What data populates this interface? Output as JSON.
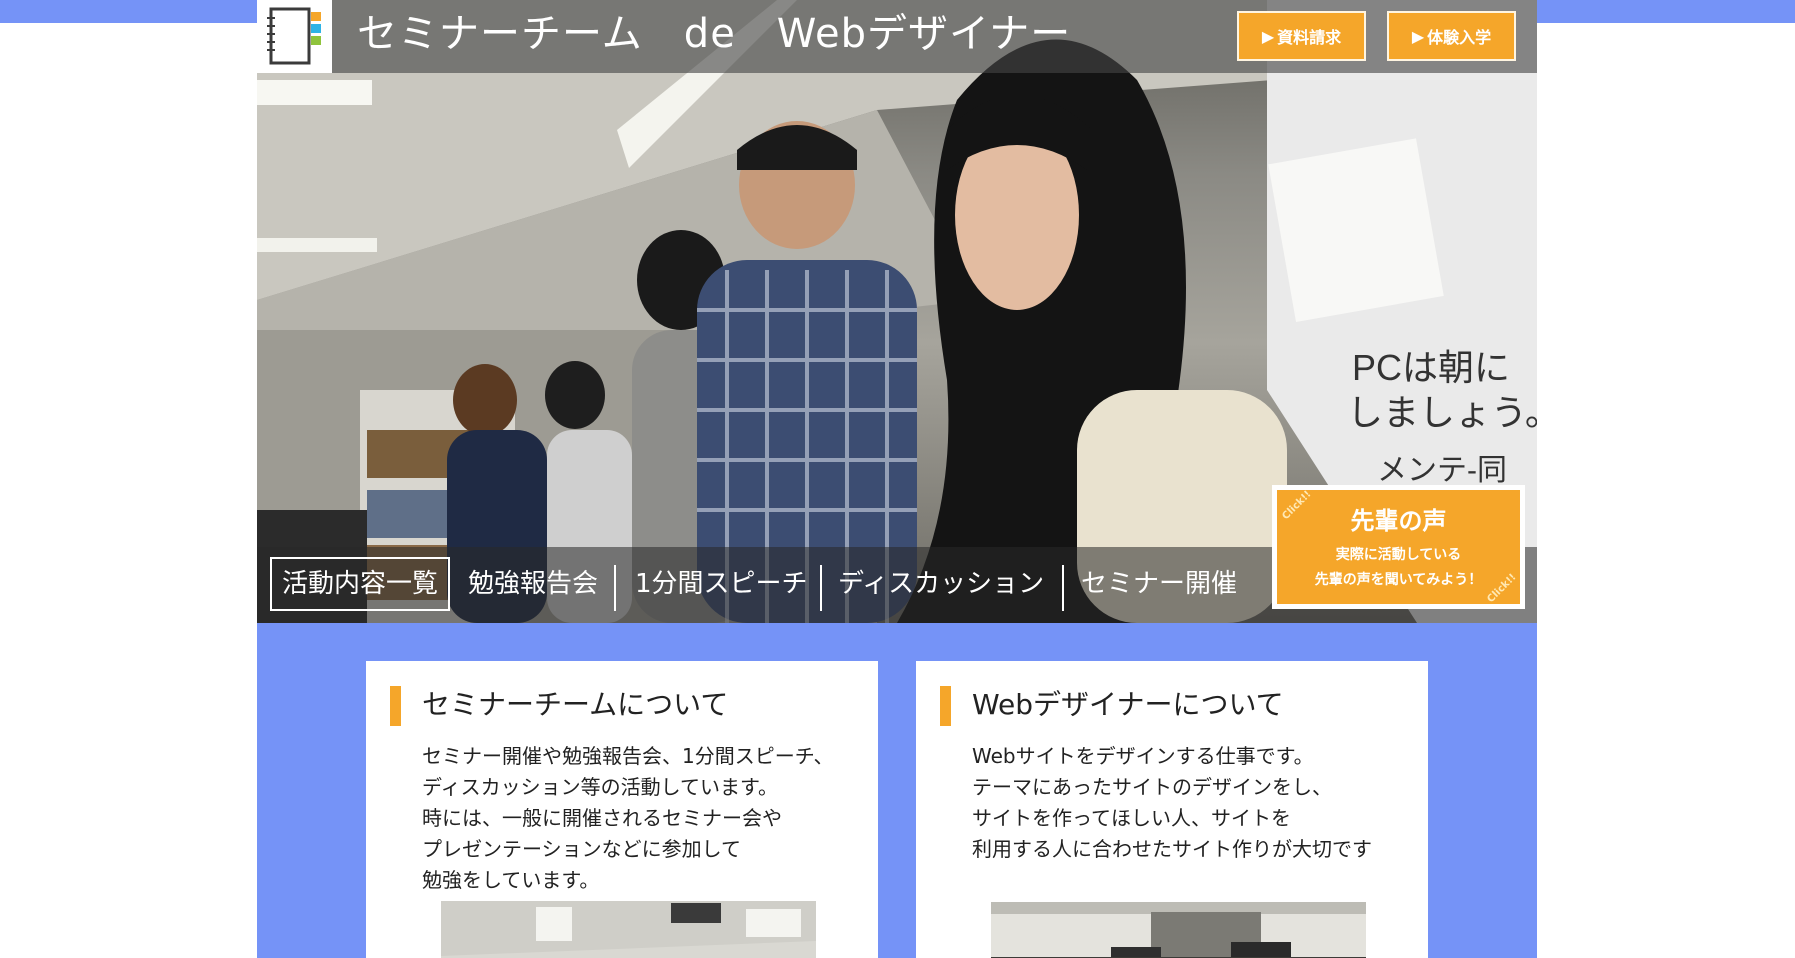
{
  "site": {
    "title": "セミナーチーム　de　Webデザイナー"
  },
  "header": {
    "buttons": [
      {
        "label": "資料請求",
        "icon": "play-triangle-icon"
      },
      {
        "label": "体験入学",
        "icon": "play-triangle-icon"
      }
    ]
  },
  "nav": {
    "items": [
      {
        "label": "活動内容一覧",
        "active": true
      },
      {
        "label": "勉強報告会"
      },
      {
        "label": "1分間スピーチ"
      },
      {
        "label": "ディスカッション"
      },
      {
        "label": "セミナー開催"
      }
    ]
  },
  "senpai": {
    "title": "先輩の声",
    "line1": "実際に活動している",
    "line2": "先輩の声を聞いてみよう！",
    "click_label": "Click!!"
  },
  "whiteboard": {
    "line1": "PCは朝に",
    "line2": "しましょう。",
    "line3": "メンテ-同"
  },
  "cards": [
    {
      "title": "セミナーチームについて",
      "body": [
        "セミナー開催や勉強報告会、1分間スピーチ、",
        "ディスカッション等の活動しています。",
        "時には、一般に開催されるセミナー会や",
        "プレゼンテーションなどに参加して",
        "勉強をしています。"
      ]
    },
    {
      "title": "Webデザイナーについて",
      "body": [
        "Webサイトをデザインする仕事です。",
        "テーマにあったサイトのデザインをし、",
        "サイトを作ってほしい人、サイトを",
        "利用する人に合わせたサイト作りが大切です"
      ]
    }
  ],
  "colors": {
    "background": "#7593f7",
    "accent": "#f5a62a",
    "card": "#ffffff"
  }
}
